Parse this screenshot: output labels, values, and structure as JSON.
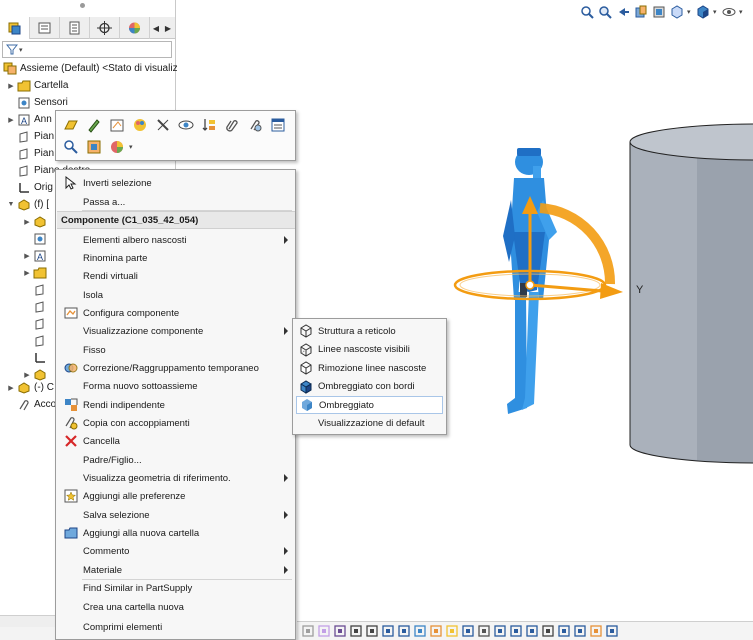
{
  "tree": {
    "root_label": "Assieme (Default) <Stato di visualizzaz",
    "items": [
      {
        "label": "Cartella",
        "icon": "folder-icon"
      },
      {
        "label": "Sensori",
        "icon": "sensor-icon"
      },
      {
        "label": "Ann",
        "icon": "annotations-icon"
      },
      {
        "label": "Pian",
        "icon": "plane-icon"
      },
      {
        "label": "Pian",
        "icon": "plane-icon"
      },
      {
        "label": "Piano destro",
        "icon": "plane-icon"
      },
      {
        "label": "Orig",
        "icon": "origin-icon"
      },
      {
        "label": "(f) [",
        "icon": "component-icon"
      },
      {
        "label": "(-) C",
        "icon": "component-icon"
      },
      {
        "label": "Acco",
        "icon": "mates-icon"
      }
    ]
  },
  "context_menu": {
    "items": [
      {
        "label": "Inverti selezione",
        "icon": "cursor-select-icon"
      },
      {
        "label": "Passa a...",
        "icon": "",
        "ul": "P"
      },
      {
        "label": "Elementi albero nascosti",
        "icon": "",
        "submenu": true
      },
      {
        "label": "Rinomina parte",
        "icon": ""
      },
      {
        "label": "Rendi virtuali",
        "icon": ""
      },
      {
        "label": "Isola",
        "icon": ""
      },
      {
        "label": "Configura componente",
        "icon": "configure-icon"
      },
      {
        "label": "Visualizzazione componente",
        "icon": "",
        "submenu": true
      },
      {
        "label": "Fisso",
        "icon": ""
      },
      {
        "label": "Correzione/Raggruppamento temporaneo",
        "icon": "temp-fix-icon"
      },
      {
        "label": "Forma nuovo sottoassieme",
        "icon": ""
      },
      {
        "label": "Rendi indipendente",
        "icon": "make-independent-icon"
      },
      {
        "label": "Copia con accoppiamenti",
        "icon": "copy-mates-icon"
      },
      {
        "label": "Cancella",
        "icon": "delete-icon"
      },
      {
        "label": "Padre/Figlio...",
        "icon": ""
      },
      {
        "label": "Visualizza geometria di riferimento.",
        "icon": "",
        "submenu": true
      },
      {
        "label": "Aggiungi alle preferenze",
        "icon": "favorites-icon"
      },
      {
        "label": "Salva selezione",
        "icon": "",
        "submenu": true
      },
      {
        "label": "Aggiungi alla nuova cartella",
        "icon": "new-folder-icon"
      },
      {
        "label": "Commento",
        "icon": "",
        "submenu": true
      },
      {
        "label": "Materiale",
        "icon": "",
        "submenu": true
      },
      {
        "label": "Find Similar in PartSupply",
        "icon": ""
      },
      {
        "label": "Crea una cartella nuova",
        "icon": ""
      },
      {
        "label": "Comprimi elementi",
        "icon": ""
      }
    ],
    "header": "Componente (C1_035_42_054)"
  },
  "submenu": {
    "items": [
      {
        "label": "Struttura a reticolo",
        "icon": "wireframe-icon"
      },
      {
        "label": "Linee nascoste visibili",
        "icon": "hidden-lines-visible-icon"
      },
      {
        "label": "Rimozione linee nascoste",
        "icon": "hidden-lines-removed-icon"
      },
      {
        "label": "Ombreggiato con bordi",
        "icon": "shaded-edges-icon"
      },
      {
        "label": "Ombreggiato",
        "icon": "shaded-icon",
        "highlighted": true
      },
      {
        "label": "Visualizzazione di default",
        "icon": ""
      }
    ]
  },
  "viewport": {
    "axis_label": "Y"
  },
  "colors": {
    "mannequin": "#2f8fe0",
    "cylinder": "#9aa2ad",
    "triad": "#f39c12",
    "accent": "#1f6fc5"
  }
}
